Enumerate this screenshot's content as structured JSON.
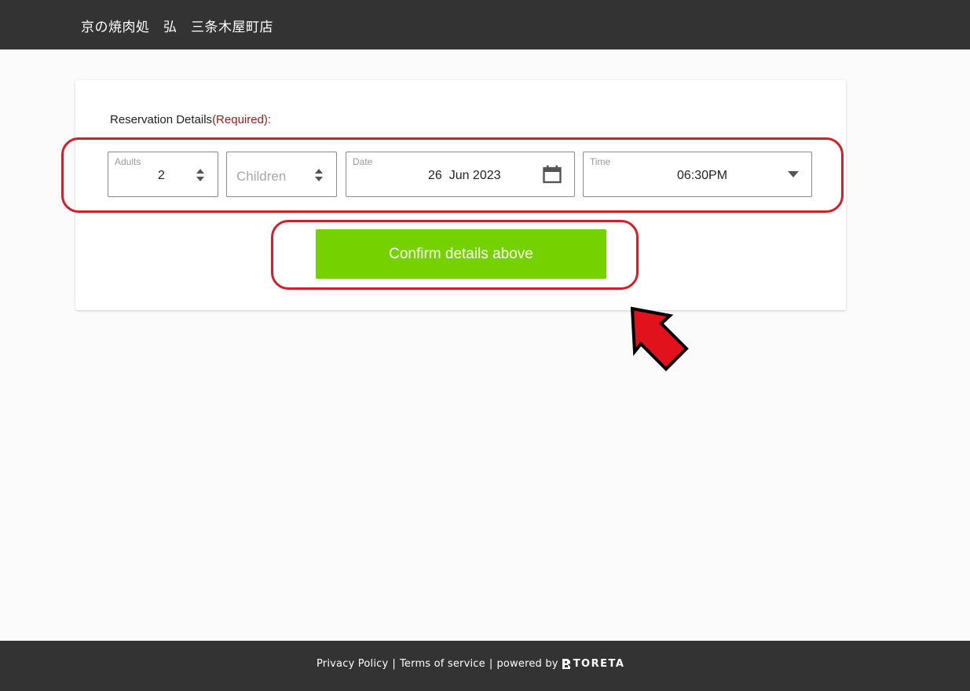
{
  "header": {
    "title": "京の焼肉処　弘　三条木屋町店"
  },
  "form": {
    "section_label": "Reservation Details",
    "required_label": "(Required):",
    "adults": {
      "label": "Adults",
      "value": "2"
    },
    "children": {
      "placeholder": "Children"
    },
    "date": {
      "label": "Date",
      "value": "26  Jun 2023"
    },
    "time": {
      "label": "Time",
      "value": "06:30PM"
    },
    "confirm_label": "Confirm details above"
  },
  "icons": {
    "spinner": "up-down-arrows-icon",
    "calendar": "calendar-icon",
    "dropdown": "caret-down-icon",
    "arrow": "red-pointer-arrow-icon",
    "brand": "toreta-logo-icon"
  },
  "colors": {
    "header_bg": "#333333",
    "confirm_button": "#76d100",
    "highlight": "#d0202a",
    "required_text": "#9b1c1c"
  },
  "footer": {
    "privacy": "Privacy Policy",
    "terms": "Terms of service",
    "powered_by": "powered by",
    "brand": "TORETA"
  }
}
